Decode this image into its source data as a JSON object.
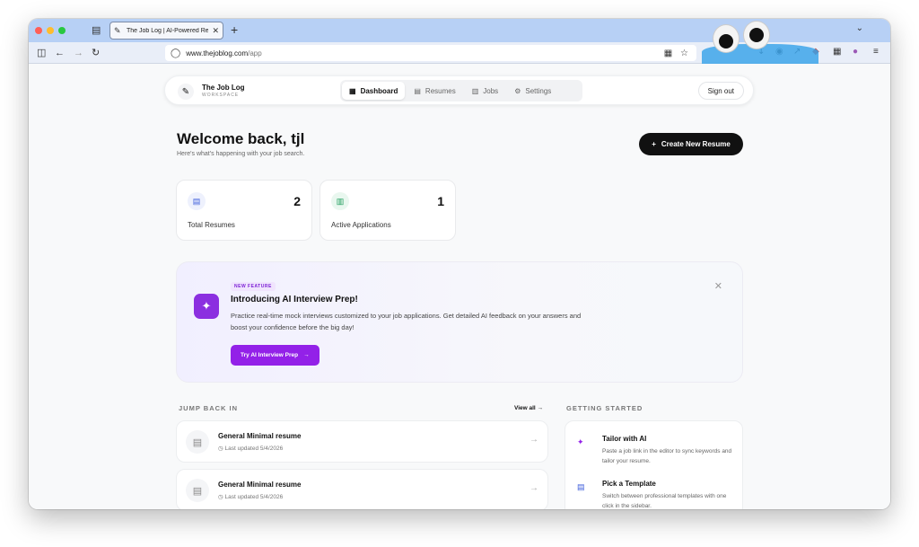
{
  "browser": {
    "tab_title": "The Job Log | AI-Powered Resu",
    "url_domain": "www.thejoblog.com",
    "url_path": "/app",
    "accent_color": "#b7d0f5"
  },
  "nav": {
    "brand_name": "The Job Log",
    "brand_sub": "WORKSPACE",
    "tabs": [
      {
        "label": "Dashboard",
        "icon": "grid-icon",
        "active": true
      },
      {
        "label": "Resumes",
        "icon": "document-icon",
        "active": false
      },
      {
        "label": "Jobs",
        "icon": "briefcase-icon",
        "active": false
      },
      {
        "label": "Settings",
        "icon": "gear-icon",
        "active": false
      }
    ],
    "sign_out": "Sign out"
  },
  "header": {
    "title": "Welcome back, tjl",
    "subtitle": "Here's what's happening with your job search.",
    "create_button": "Create New Resume"
  },
  "stats": [
    {
      "value": "2",
      "label": "Total Resumes",
      "icon": "document-icon",
      "color": "#3b5bdb"
    },
    {
      "value": "1",
      "label": "Active Applications",
      "icon": "briefcase-icon",
      "color": "#1c9b5a"
    }
  ],
  "feature": {
    "badge": "NEW FEATURE",
    "title": "Introducing AI Interview Prep!",
    "description": "Practice real-time mock interviews customized to your job applications. Get detailed AI feedback on your answers and boost your confidence before the big day!",
    "button": "Try AI Interview Prep",
    "accent": "#9321e8"
  },
  "jump_back": {
    "label": "JUMP BACK IN",
    "view_all": "View all",
    "items": [
      {
        "title": "General Minimal resume",
        "updated": "Last updated 5/4/2026"
      },
      {
        "title": "General Minimal resume",
        "updated": "Last updated 5/4/2026"
      }
    ]
  },
  "getting_started": {
    "label": "GETTING STARTED",
    "items": [
      {
        "title": "Tailor with AI",
        "desc": "Paste a job link in the editor to sync keywords and tailor your resume.",
        "icon": "sparkle-icon"
      },
      {
        "title": "Pick a Template",
        "desc": "Switch between professional templates with one click in the sidebar.",
        "icon": "layout-icon"
      }
    ]
  }
}
